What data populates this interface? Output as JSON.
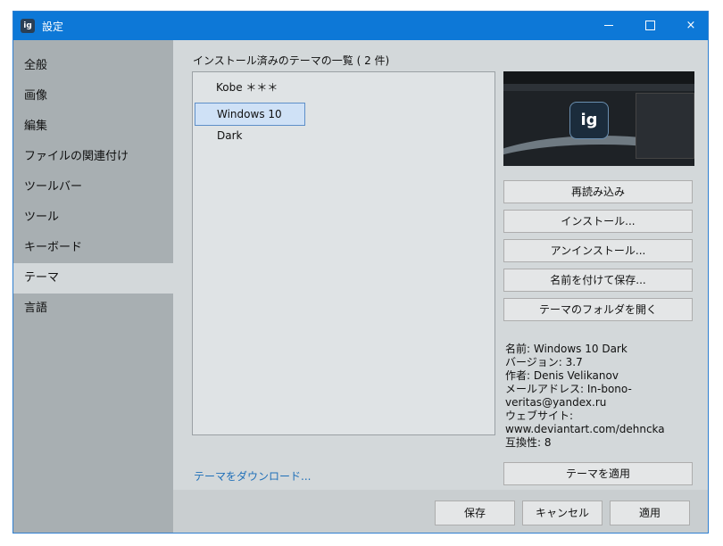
{
  "window": {
    "title": "設定",
    "app_icon_label": "ig",
    "controls": {
      "minimize": "minimize-icon",
      "maximize": "maximize-icon",
      "close": "×"
    }
  },
  "sidebar": {
    "items": [
      {
        "label": "全般"
      },
      {
        "label": "画像"
      },
      {
        "label": "編集"
      },
      {
        "label": "ファイルの関連付け"
      },
      {
        "label": "ツールバー"
      },
      {
        "label": "ツール"
      },
      {
        "label": "キーボード"
      },
      {
        "label": "テーマ",
        "active": true
      },
      {
        "label": "言語"
      }
    ]
  },
  "themes": {
    "list_title": "インストール済みのテーマの一覧 ( 2 件)",
    "items": [
      {
        "label": "Kobe ＊＊＊",
        "selected": false
      },
      {
        "label": "Windows 10 Dark",
        "selected": true
      }
    ]
  },
  "preview": {
    "logo_text": "ig"
  },
  "actions": {
    "reload": "再読み込み",
    "install": "インストール...",
    "uninstall": "アンインストール...",
    "save_as": "名前を付けて保存...",
    "open_folder": "テーマのフォルダを開く",
    "apply_theme": "テーマを適用"
  },
  "info": {
    "name": "名前: Windows 10 Dark",
    "version": "バージョン: 3.7",
    "author": "作者: Denis Velikanov",
    "email_1": "メールアドレス: In-bono-",
    "email_2": "veritas@yandex.ru",
    "website": "ウェブサイト:",
    "website_url": "www.deviantart.com/dehncka",
    "compat": "互換性: 8"
  },
  "download_link": "テーマをダウンロード...",
  "footer": {
    "save": "保存",
    "cancel": "キャンセル",
    "apply": "適用"
  },
  "colors": {
    "titlebar": "#0d78d7",
    "sidebar": "#a8afb2",
    "content": "#d3d8da",
    "selection": "#cfe1f6",
    "link": "#1f6fb8"
  }
}
